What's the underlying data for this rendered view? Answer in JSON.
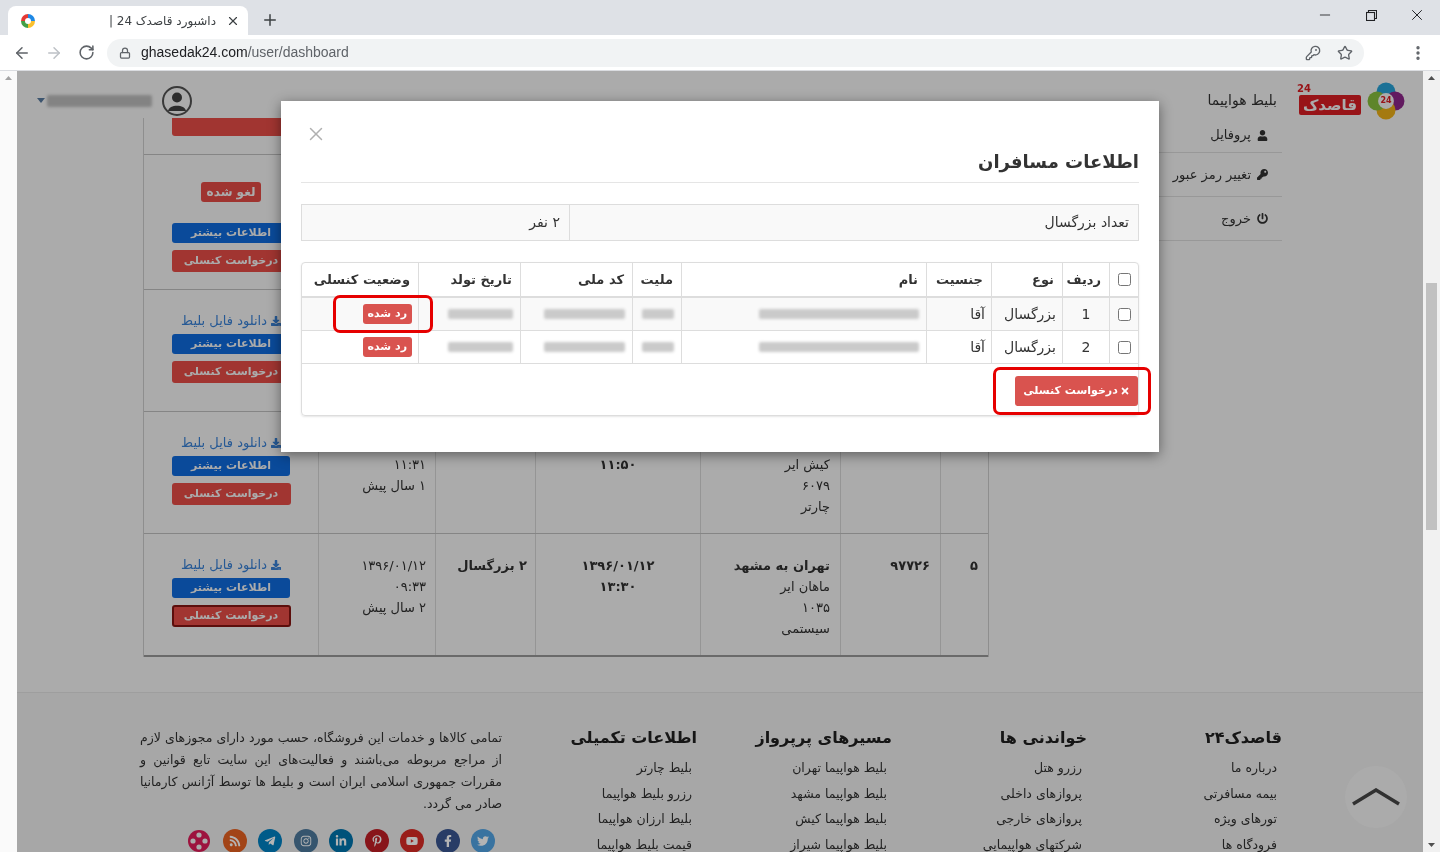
{
  "browser": {
    "tab_title": "داشبورد قاصدک 24 |",
    "url_host": "ghasedak24.com",
    "url_path": "/user/dashboard"
  },
  "header": {
    "logo": {
      "emblem_number": "24",
      "wordmark": "قاصدک",
      "wordmark_number": "24"
    },
    "nav": [
      "بلیط هواپیما"
    ]
  },
  "account_menu": [
    {
      "kind": "profile",
      "label": "پروفایل"
    },
    {
      "kind": "password",
      "label": "تغییر رمز عبور"
    },
    {
      "kind": "logout",
      "label": "خروج"
    }
  ],
  "orders": [
    {
      "kind": "cut_off"
    },
    {
      "kind": "order",
      "badge": "لغو شده",
      "info_button": "اطلاعات بیشتر",
      "cancel_button": {
        "label": "درخواست کنسلی",
        "focused": false
      }
    },
    {
      "kind": "order",
      "download_link": "دانلود فایل بلیط",
      "info_button": "اطلاعات بیشتر",
      "cancel_button": {
        "label": "درخواست کنسلی",
        "focused": false
      }
    },
    {
      "kind": "order",
      "first_line_covered": true,
      "cells": {
        "column_3": [
          "کیش ایر",
          "۶۰۷۹",
          "چارتر"
        ],
        "column_4": [
          "۱۱:۵۰"
        ],
        "column_6": [
          "۱۱:۳۱",
          "۱ سال پیش"
        ]
      },
      "download_link": "دانلود فایل بلیط",
      "info_button": "اطلاعات بیشتر",
      "cancel_button": {
        "label": "درخواست کنسلی",
        "focused": false
      }
    },
    {
      "kind": "order",
      "cells": {
        "column_1": [
          "۵"
        ],
        "column_2": [
          "۹۷۷۲۶"
        ],
        "column_3": [
          "تهران به مشهد",
          "ماهان ایر",
          "۱۰۳۵",
          "سیستمی"
        ],
        "column_4": [
          "۱۳۹۶/۰۱/۱۲",
          "۱۳:۳۰"
        ],
        "column_5": [
          "۲ بزرگسال"
        ],
        "column_6": [
          "۱۳۹۶/۰۱/۱۲",
          "۰۹:۳۳",
          "۲ سال پیش"
        ]
      },
      "download_link": "دانلود فایل بلیط",
      "info_button": "اطلاعات بیشتر",
      "cancel_button": {
        "label": "درخواست کنسلی",
        "focused": true
      }
    }
  ],
  "footer": {
    "columns": [
      {
        "title": "قاصدک۲۴",
        "links": [
          "درباره ما",
          "بیمه مسافرتی",
          "تورهای ویژه",
          "فرودگاه ها"
        ]
      },
      {
        "title": "خواندنی ها",
        "links": [
          "رزرو هتل",
          "پروازهای داخلی",
          "پروازهای خارجی",
          "شرکتهای هواپیمایی"
        ]
      },
      {
        "title": "مسیرهای پرپرواز",
        "links": [
          "بلیط هواپیما تهران",
          "بلیط هواپیما مشهد",
          "بلیط هواپیما کیش",
          "بلیط هواپیما شیراز"
        ]
      },
      {
        "title": "اطلاعات تکمیلی",
        "links": [
          "بلیط چارتر",
          "رزرو بلیط هواپیما",
          "بلیط ارزان هواپیما",
          "قیمت بلیط هواپیما"
        ]
      }
    ],
    "about": "تمامی کالاها و خدمات این فروشگاه، حسب مورد دارای مجوزهای لازم از مراجع مربوطه می‌باشند و فعالیت‌های این سایت تابع قوانین و مقررات جمهوری اسلامی ایران است و بلیط ها توسط آژانس کارمانیا صادر می گردد.",
    "social": [
      {
        "kind": "twitter",
        "color": "#3973a0"
      },
      {
        "kind": "facebook",
        "color": "#283c66"
      },
      {
        "kind": "youtube",
        "color": "#991e1a"
      },
      {
        "kind": "pinterest",
        "color": "#88151a"
      },
      {
        "kind": "linkedin",
        "color": "#00527a"
      },
      {
        "kind": "instagram",
        "color": "#36556e"
      },
      {
        "kind": "telegram",
        "color": "#005b89"
      },
      {
        "kind": "rss",
        "color": "#a24417"
      },
      {
        "kind": "reel",
        "color": "#9d133e"
      }
    ]
  },
  "modal": {
    "title": "اطلاعات مسافران",
    "summary": [
      {
        "label": "تعداد بزرگسال",
        "value": "۲ نفر"
      }
    ],
    "passengers": {
      "select_all": false,
      "columns": [
        "ردیف",
        "نوع",
        "جنسیت",
        "نام",
        "ملیت",
        "کد ملی",
        "تاریخ تولد",
        "وضعیت کنسلی"
      ],
      "rows": [
        {
          "checked": false,
          "cells": [
            {
              "kind": "text",
              "text": "1"
            },
            {
              "kind": "text",
              "text": "بزرگسال"
            },
            {
              "kind": "text",
              "text": "آقا"
            },
            {
              "kind": "blurred"
            },
            {
              "kind": "blurred"
            },
            {
              "kind": "blurred"
            },
            {
              "kind": "blurred"
            },
            {
              "kind": "badge",
              "text": "رد شده",
              "highlighted": true
            }
          ]
        },
        {
          "checked": false,
          "cells": [
            {
              "kind": "text",
              "text": "2"
            },
            {
              "kind": "text",
              "text": "بزرگسال"
            },
            {
              "kind": "text",
              "text": "آقا"
            },
            {
              "kind": "blurred"
            },
            {
              "kind": "blurred"
            },
            {
              "kind": "blurred"
            },
            {
              "kind": "blurred"
            },
            {
              "kind": "badge",
              "text": "رد شده",
              "highlighted": false
            }
          ]
        }
      ]
    },
    "cancel_button": {
      "label": "درخواست کنسلی",
      "highlighted": true
    }
  }
}
